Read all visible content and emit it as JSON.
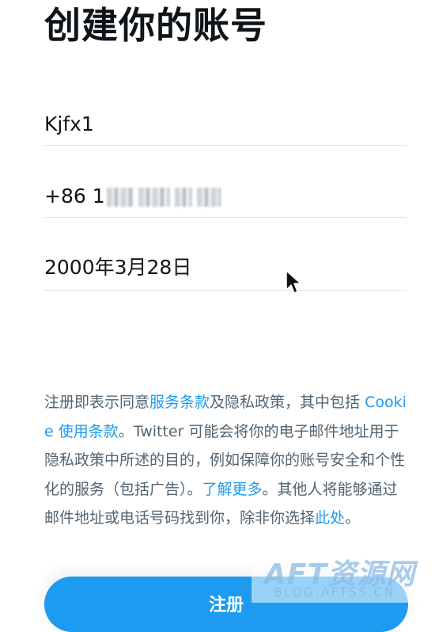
{
  "page": {
    "title": "创建你的账号"
  },
  "fields": {
    "name": "Kjfx1",
    "phone": "+86 1",
    "dob": "2000年3月28日"
  },
  "terms": {
    "p1": "注册即表示同意",
    "link_tos": "服务条款",
    "p2": "及隐私政策，其中包括 ",
    "link_cookie": "Cookie 使用条款",
    "p3": "。Twitter 可能会将你的电子邮件地址用于隐私政策中所述的目的，例如保障你的账号安全和个性化的服务（包括广告）。",
    "link_learn": "了解更多",
    "p4": "。其他人将能够通过邮件地址或电话号码找到你，除非你选择",
    "link_here": "此处",
    "p5": "。"
  },
  "button": {
    "register": "注册"
  },
  "watermark": {
    "main": "AFT资源网",
    "sub": "BLOG.AFTSS.CN"
  },
  "colors": {
    "accent": "#1d9bf0",
    "text": "#0f1419",
    "muted": "#536471"
  }
}
